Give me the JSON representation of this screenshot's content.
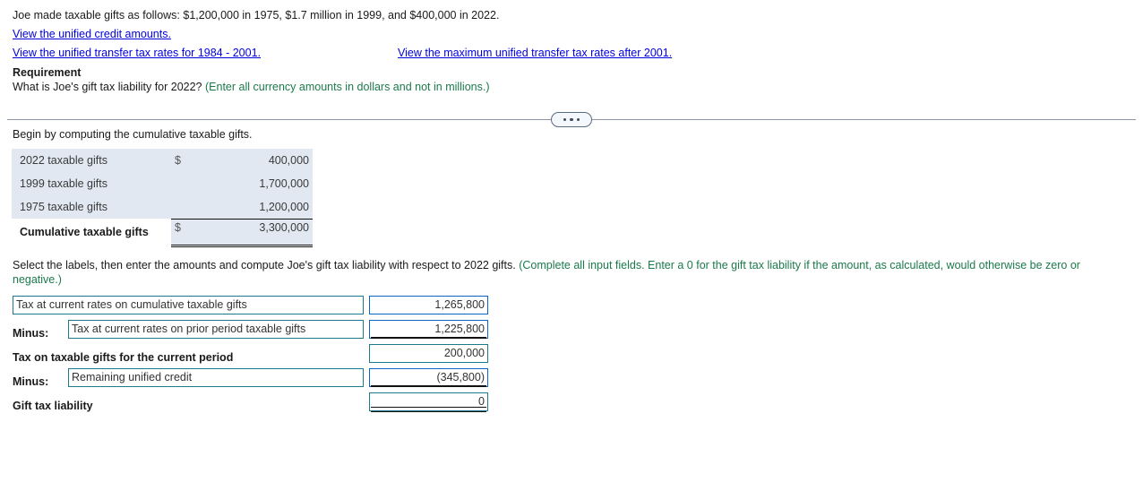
{
  "problem": {
    "statement": "Joe made taxable gifts as follows: $1,200,000 in 1975, $1.7 million in 1999, and $400,000 in 2022.",
    "links": [
      {
        "text": "View the unified credit amounts."
      },
      {
        "text": "View the unified transfer tax rates for 1984 - 2001."
      },
      {
        "text": "View the maximum unified transfer tax rates after 2001."
      }
    ],
    "requirement_title": "Requirement",
    "requirement_question": "What is Joe's gift tax liability for 2022?",
    "requirement_hint": "(Enter all currency amounts in dollars and not in millions.)"
  },
  "divider": {
    "button_name": "more-options"
  },
  "worksheet": {
    "begin_text": "Begin by computing the cumulative taxable gifts.",
    "table": {
      "rows": [
        {
          "label": "2022 taxable gifts",
          "currency": "$",
          "amount": "400,000"
        },
        {
          "label": "1999 taxable gifts",
          "currency": "",
          "amount": "1,700,000"
        },
        {
          "label": "1975 taxable gifts",
          "currency": "",
          "amount": "1,200,000"
        }
      ],
      "total": {
        "label": "Cumulative taxable gifts",
        "currency": "$",
        "amount": "3,300,000"
      }
    },
    "select_instruction": "Select the labels, then enter the amounts and compute Joe's gift tax liability with respect to 2022 gifts.",
    "select_hint": "(Complete all input fields. Enter a 0 for the gift tax liability if the amount, as calculated, would otherwise be zero or negative.)",
    "answer_rows": [
      {
        "prefix": "",
        "label": "Tax at current rates on cumulative taxable gifts",
        "amount": "1,265,800"
      },
      {
        "prefix": "Minus:",
        "label": "Tax at current rates on prior period taxable gifts",
        "amount": "1,225,800"
      },
      {
        "prefix": "",
        "label": "Tax on taxable gifts for the current period",
        "amount": "200,000"
      },
      {
        "prefix": "Minus:",
        "label": "Remaining unified credit",
        "amount": "(345,800)"
      },
      {
        "prefix": "",
        "label": "Gift tax liability",
        "amount": "0"
      }
    ]
  },
  "colors": {
    "link": "#0000e0",
    "hint_green": "#1b7a4a",
    "table_bg": "#e1e8f2",
    "input_border_teal": "#1d7b89",
    "input_border_blue": "#0b63c5"
  }
}
